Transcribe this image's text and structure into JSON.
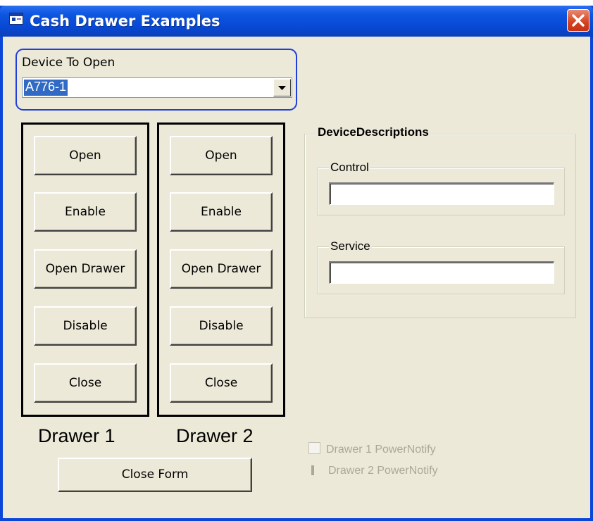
{
  "window": {
    "title": "Cash Drawer Examples"
  },
  "device": {
    "label": "Device To Open",
    "value": "A776-1"
  },
  "drawer1": {
    "label": "Drawer 1",
    "buttons": [
      "Open",
      "Enable",
      "Open Drawer",
      "Disable",
      "Close"
    ]
  },
  "drawer2": {
    "label": "Drawer 2",
    "buttons": [
      "Open",
      "Enable",
      "Open Drawer",
      "Disable",
      "Close"
    ]
  },
  "close_form": "Close Form",
  "descriptions": {
    "title": "DeviceDescriptions",
    "control_label": "Control",
    "control_value": "",
    "service_label": "Service",
    "service_value": ""
  },
  "checkboxes": {
    "drawer1_power": "Drawer 1 PowerNotify",
    "drawer2_power": "Drawer 2 PowerNotify"
  },
  "colors": {
    "titlebar": "#0848d4",
    "face": "#ece9d8",
    "focus_border": "#1f3fdc",
    "selection": "#316ac5",
    "close_button": "#d6411e"
  }
}
